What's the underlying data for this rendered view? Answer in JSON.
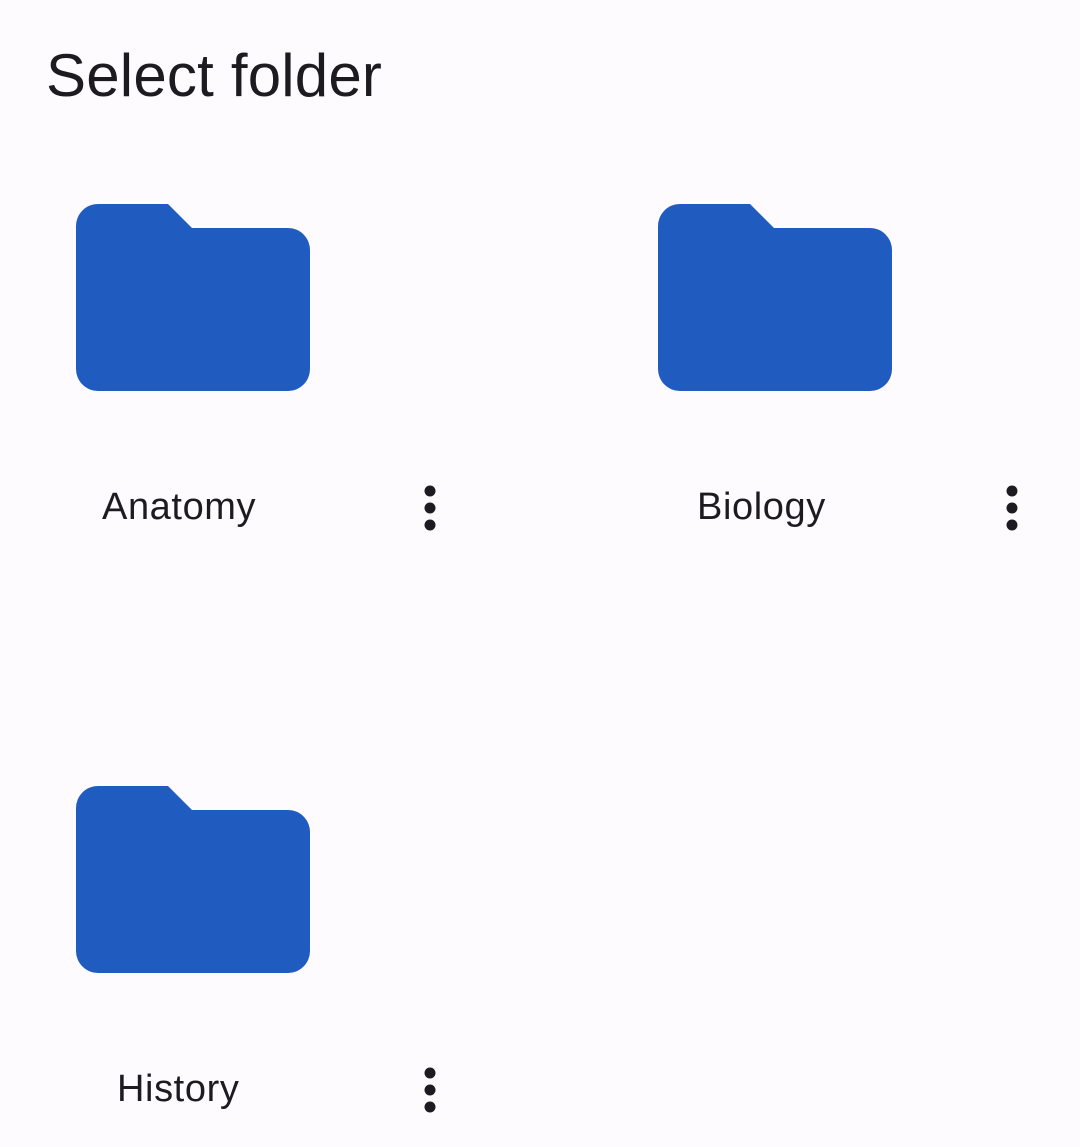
{
  "page": {
    "title": "Select folder"
  },
  "colors": {
    "background": "#fdfbfe",
    "folder": "#205bbf",
    "text": "#1d1b20"
  },
  "folders": [
    {
      "name": "Anatomy",
      "icon": "folder-icon",
      "menu_icon": "more-vert-icon"
    },
    {
      "name": "Biology",
      "icon": "folder-icon",
      "menu_icon": "more-vert-icon"
    },
    {
      "name": "History",
      "icon": "folder-icon",
      "menu_icon": "more-vert-icon"
    }
  ]
}
